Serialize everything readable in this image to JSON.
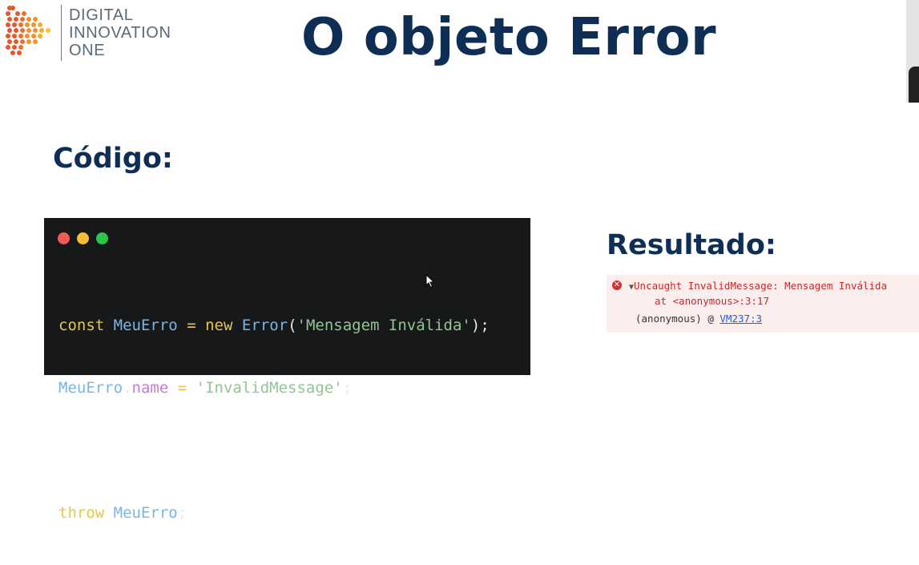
{
  "logo": {
    "line1": "DIGITAL",
    "line2": "INNOVATION",
    "line3": "ONE"
  },
  "slide": {
    "title": "O objeto Error",
    "code_heading": "Código:",
    "result_heading": "Resultado:"
  },
  "code_window": {
    "dot_colors": [
      "#ee5b55",
      "#f6bd3a",
      "#2fc349"
    ],
    "line1": {
      "kw": "const",
      "var": "MeuErro",
      "op": "=",
      "kw2": "new",
      "cls": "Error",
      "open": "(",
      "str": "'Mensagem Inválida'",
      "close": ");"
    },
    "line2": {
      "var": "MeuErro",
      "dot": ".",
      "prop": "name",
      "op": "=",
      "str": "'InvalidMessage'",
      "end": ";"
    },
    "line4": {
      "kw": "throw",
      "var": "MeuErro",
      "end": ";"
    }
  },
  "console": {
    "icon": "error-icon",
    "message": "Uncaught InvalidMessage: Mensagem Inválida",
    "stack_line": "at <anonymous>:3:17",
    "caller": "(anonymous)",
    "at_sign": "@",
    "source_link": "VM237:3",
    "colors": {
      "error_text": "#c8282a",
      "error_background": "#fdeeee",
      "link": "#1a63d6"
    }
  },
  "colors": {
    "heading": "#0f2e55",
    "code_background": "#17181a"
  }
}
